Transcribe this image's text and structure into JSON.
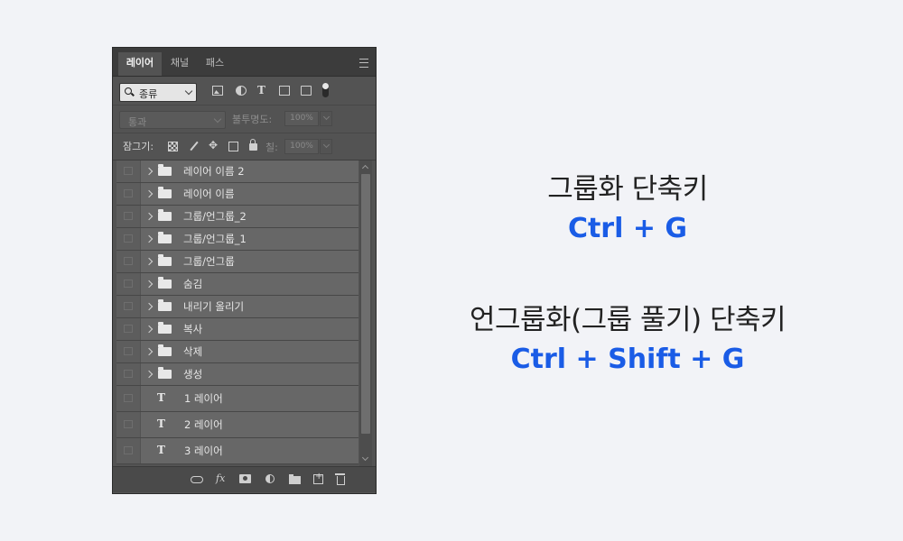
{
  "layers_panel": {
    "tabs": [
      "레이어",
      "채널",
      "패스"
    ],
    "filter": {
      "kind_label": "종류"
    },
    "blend_mode": "통과",
    "opacity_label": "불투명도:",
    "opacity_value": "100%",
    "lock_label": "잠그기:",
    "fill_label": "칠:",
    "fill_value": "100%",
    "layers": [
      {
        "type": "group",
        "name": "레이어 이름 2"
      },
      {
        "type": "group",
        "name": "레이어 이름"
      },
      {
        "type": "group",
        "name": "그룹/언그룹_2"
      },
      {
        "type": "group",
        "name": "그룹/언그룹_1"
      },
      {
        "type": "group",
        "name": "그룹/언그룹"
      },
      {
        "type": "group",
        "name": "숨김"
      },
      {
        "type": "group",
        "name": "내리기 올리기"
      },
      {
        "type": "group",
        "name": "복사"
      },
      {
        "type": "group",
        "name": "삭제"
      },
      {
        "type": "group",
        "name": "생성"
      },
      {
        "type": "text",
        "name": "1 레이어"
      },
      {
        "type": "text",
        "name": "2 레이어"
      },
      {
        "type": "text",
        "name": "3 레이어"
      }
    ]
  },
  "shortcuts": {
    "group_title": "그룹화 단축키",
    "group_key": "Ctrl + G",
    "ungroup_title": "언그룹화(그룹 풀기) 단축키",
    "ungroup_key": "Ctrl + Shift + G"
  },
  "colors": {
    "accent": "#1a5ce6",
    "panel_bg": "#535353",
    "page_bg": "#f2f3f7"
  }
}
